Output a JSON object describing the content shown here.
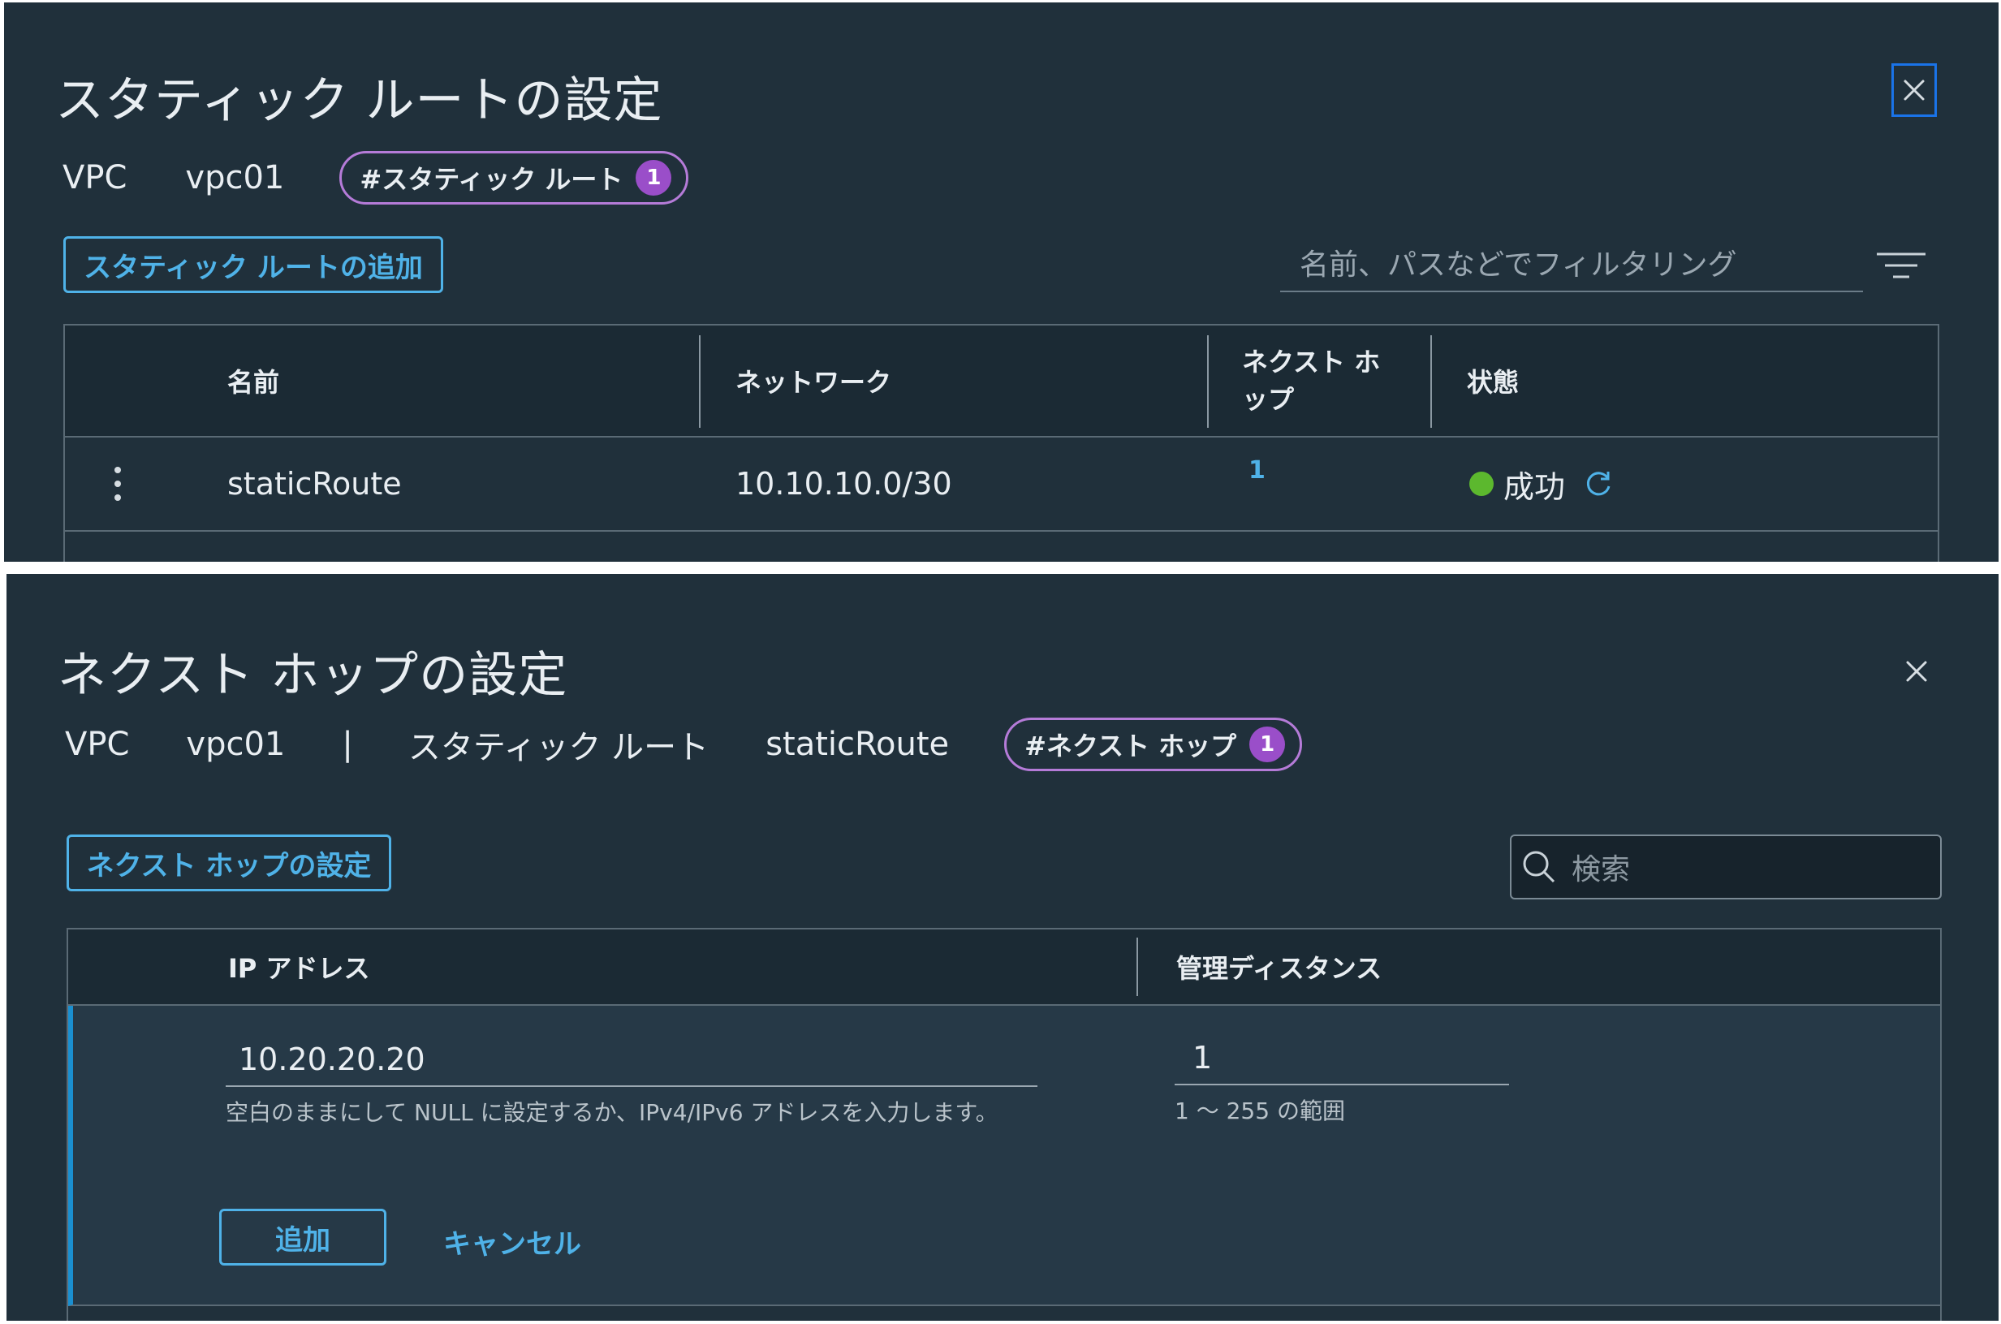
{
  "colors": {
    "panel_bg": "#20303b",
    "accent": "#4fb2e8",
    "badge": "#9a4ec9",
    "success": "#5cb82e",
    "focus": "#1a73e8"
  },
  "static_route_dialog": {
    "title": "スタティック ルートの設定",
    "close_icon": "close-icon",
    "breadcrumb": {
      "vpc_label": "VPC",
      "vpc_value": "vpc01",
      "badge_label": "#スタティック ルート",
      "badge_count": "1"
    },
    "add_button": "スタティック ルートの追加",
    "filter_placeholder": "名前、パスなどでフィルタリング",
    "filter_icon": "filter-icon",
    "columns": [
      "名前",
      "ネットワーク",
      "ネクスト ホップ",
      "状態"
    ],
    "rows": [
      {
        "name": "staticRoute",
        "network": "10.10.10.0/30",
        "next_hop": "1",
        "status": "成功",
        "status_icon": "success-dot-icon",
        "refresh_icon": "refresh-icon"
      }
    ]
  },
  "next_hop_dialog": {
    "title": "ネクスト ホップの設定",
    "close_icon": "close-icon",
    "breadcrumb": {
      "vpc_label": "VPC",
      "vpc_value": "vpc01",
      "separator": "|",
      "route_label": "スタティック ルート",
      "route_value": "staticRoute",
      "badge_label": "#ネクスト ホップ",
      "badge_count": "1"
    },
    "set_button": "ネクスト ホップの設定",
    "search_placeholder": "検索",
    "columns": [
      "IP アドレス",
      "管理ディスタンス"
    ],
    "edit_row": {
      "ip_value": "10.20.20.20",
      "ip_hint": "空白のままにして NULL に設定するか、IPv4/IPv6 アドレスを入力します。",
      "distance_value": "1",
      "distance_hint": "1 〜 255 の範囲",
      "add_button": "追加",
      "cancel_link": "キャンセル"
    }
  }
}
